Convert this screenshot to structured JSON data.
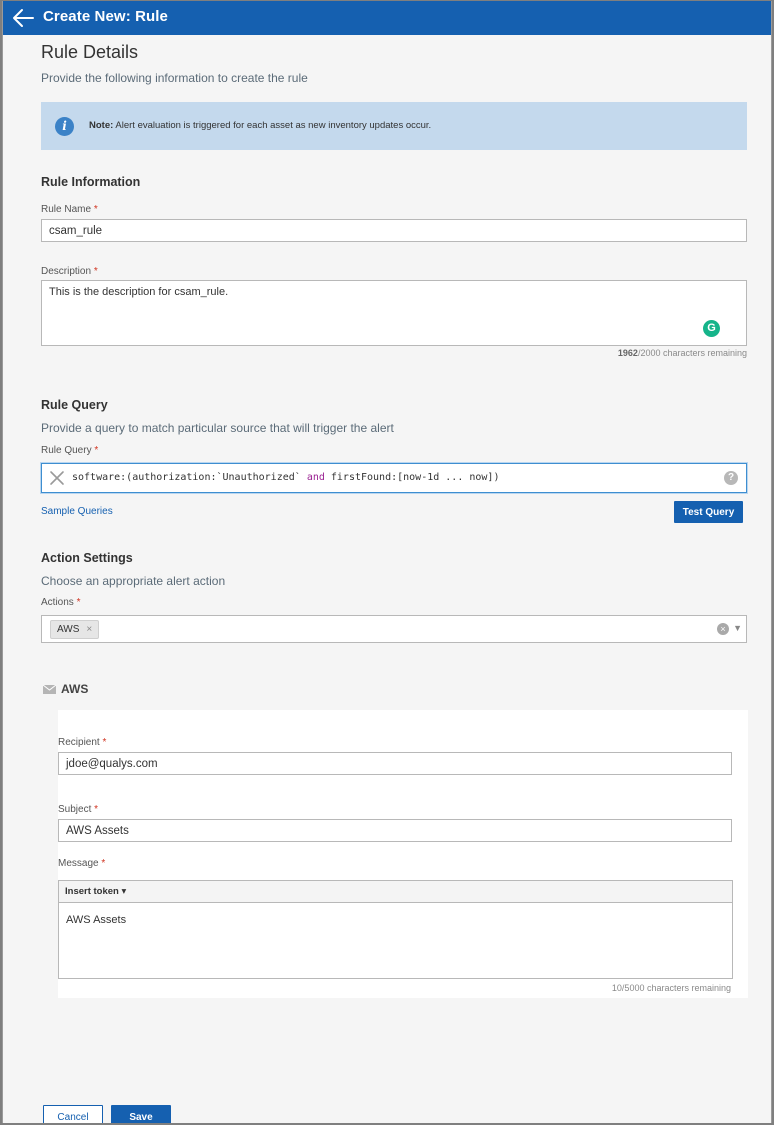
{
  "header": {
    "title": "Create New: Rule"
  },
  "details": {
    "title": "Rule Details",
    "subtitle": "Provide the following information to create the rule",
    "note_label": "Note:",
    "note_text": "Alert evaluation is triggered for each asset as new inventory updates occur."
  },
  "rule_info": {
    "title": "Rule Information",
    "name_label": "Rule Name",
    "name_value": "csam_rule",
    "desc_label": "Description",
    "desc_value": "This is the description for csam_rule.",
    "desc_count": "1962",
    "desc_count_suffix": "/2000 characters remaining"
  },
  "rule_query": {
    "title": "Rule Query",
    "subtitle": "Provide a query to match particular source that will trigger the alert",
    "label": "Rule Query",
    "query_part1": "software:(authorization:`Unauthorized` ",
    "query_keyword": "and",
    "query_part2": " firstFound:[now-1d ... now])",
    "sample_link": "Sample Queries",
    "test_button": "Test Query"
  },
  "action_settings": {
    "title": "Action Settings",
    "subtitle": "Choose an appropriate alert action",
    "label": "Actions",
    "selected_tag": "AWS"
  },
  "aws": {
    "title": "AWS",
    "recipient_label": "Recipient",
    "recipient_value": "jdoe@qualys.com",
    "subject_label": "Subject",
    "subject_value": "AWS Assets",
    "message_label": "Message",
    "insert_token": "Insert token ▾",
    "message_value": "AWS Assets",
    "message_count": "10/5000 characters remaining"
  },
  "footer": {
    "cancel": "Cancel",
    "save": "Save"
  },
  "required_mark": "*",
  "colors": {
    "primary": "#1560b0",
    "note_bg": "#c4d9ed",
    "required": "#d0321f"
  }
}
